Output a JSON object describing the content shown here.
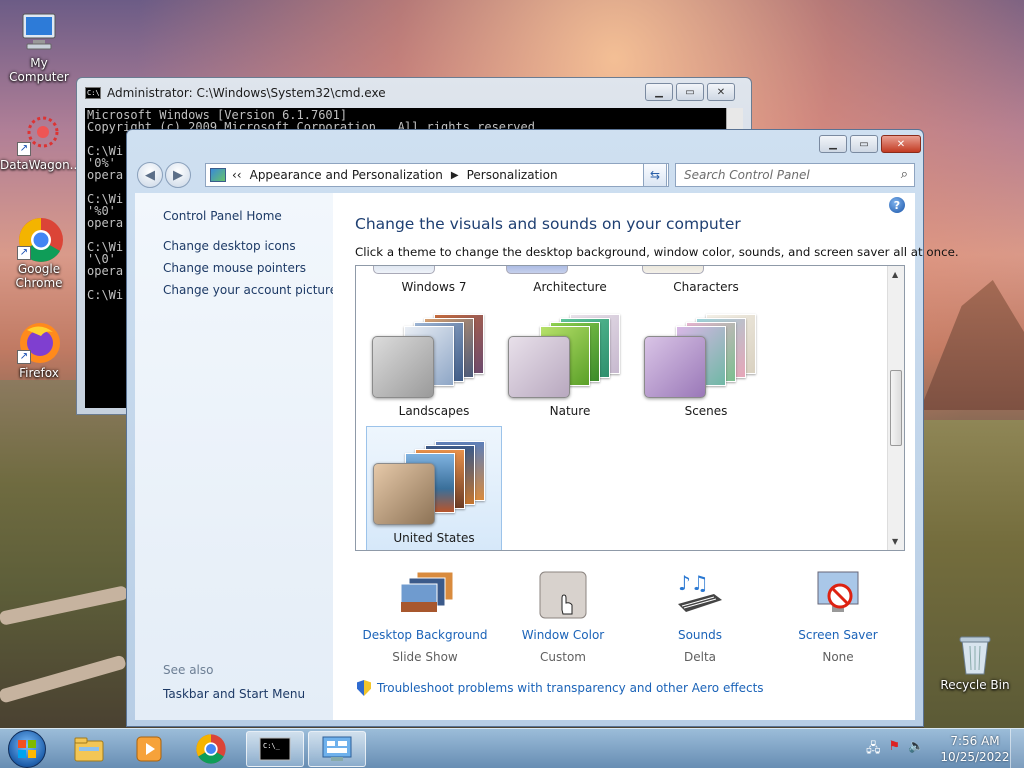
{
  "desktop": {
    "icons": [
      {
        "label": "My Computer"
      },
      {
        "label": "DataWagon..."
      },
      {
        "label": "Google Chrome"
      },
      {
        "label": "Firefox"
      },
      {
        "label": "Recycle Bin"
      }
    ]
  },
  "cmd": {
    "title": "Administrator: C:\\Windows\\System32\\cmd.exe",
    "lines": [
      "Microsoft Windows [Version 6.1.7601]",
      "Copyright (c) 2009 Microsoft Corporation.  All rights reserved.",
      "",
      "C:\\Wi",
      "'0%'",
      "opera",
      "",
      "C:\\Wi",
      "'%0'",
      "opera",
      "",
      "C:\\Wi",
      "'\\0'",
      "opera",
      "",
      "C:\\Wi"
    ]
  },
  "control_panel": {
    "address": {
      "back": "‹‹",
      "crumb1": "Appearance and Personalization",
      "crumb2": "Personalization"
    },
    "search_placeholder": "Search Control Panel",
    "left_links": {
      "home": "Control Panel Home",
      "desktop_icons": "Change desktop icons",
      "mouse_pointers": "Change mouse pointers",
      "account_picture": "Change your account picture",
      "see_also": "See also",
      "taskbar": "Taskbar and Start Menu"
    },
    "heading": "Change the visuals and sounds on your computer",
    "subheading": "Click a theme to change the desktop background, window color, sounds, and screen saver all at once.",
    "themes_top_row": [
      "Windows 7",
      "Architecture",
      "Characters"
    ],
    "themes": [
      {
        "name": "Landscapes"
      },
      {
        "name": "Nature"
      },
      {
        "name": "Scenes"
      },
      {
        "name": "United States",
        "selected": true
      }
    ],
    "bottom": [
      {
        "title": "Desktop Background",
        "sub": "Slide Show"
      },
      {
        "title": "Window Color",
        "sub": "Custom"
      },
      {
        "title": "Sounds",
        "sub": "Delta"
      },
      {
        "title": "Screen Saver",
        "sub": "None"
      }
    ],
    "troubleshoot": "Troubleshoot problems with transparency and other Aero effects"
  },
  "taskbar": {
    "time": "7:56 AM",
    "date": "10/25/2022"
  }
}
